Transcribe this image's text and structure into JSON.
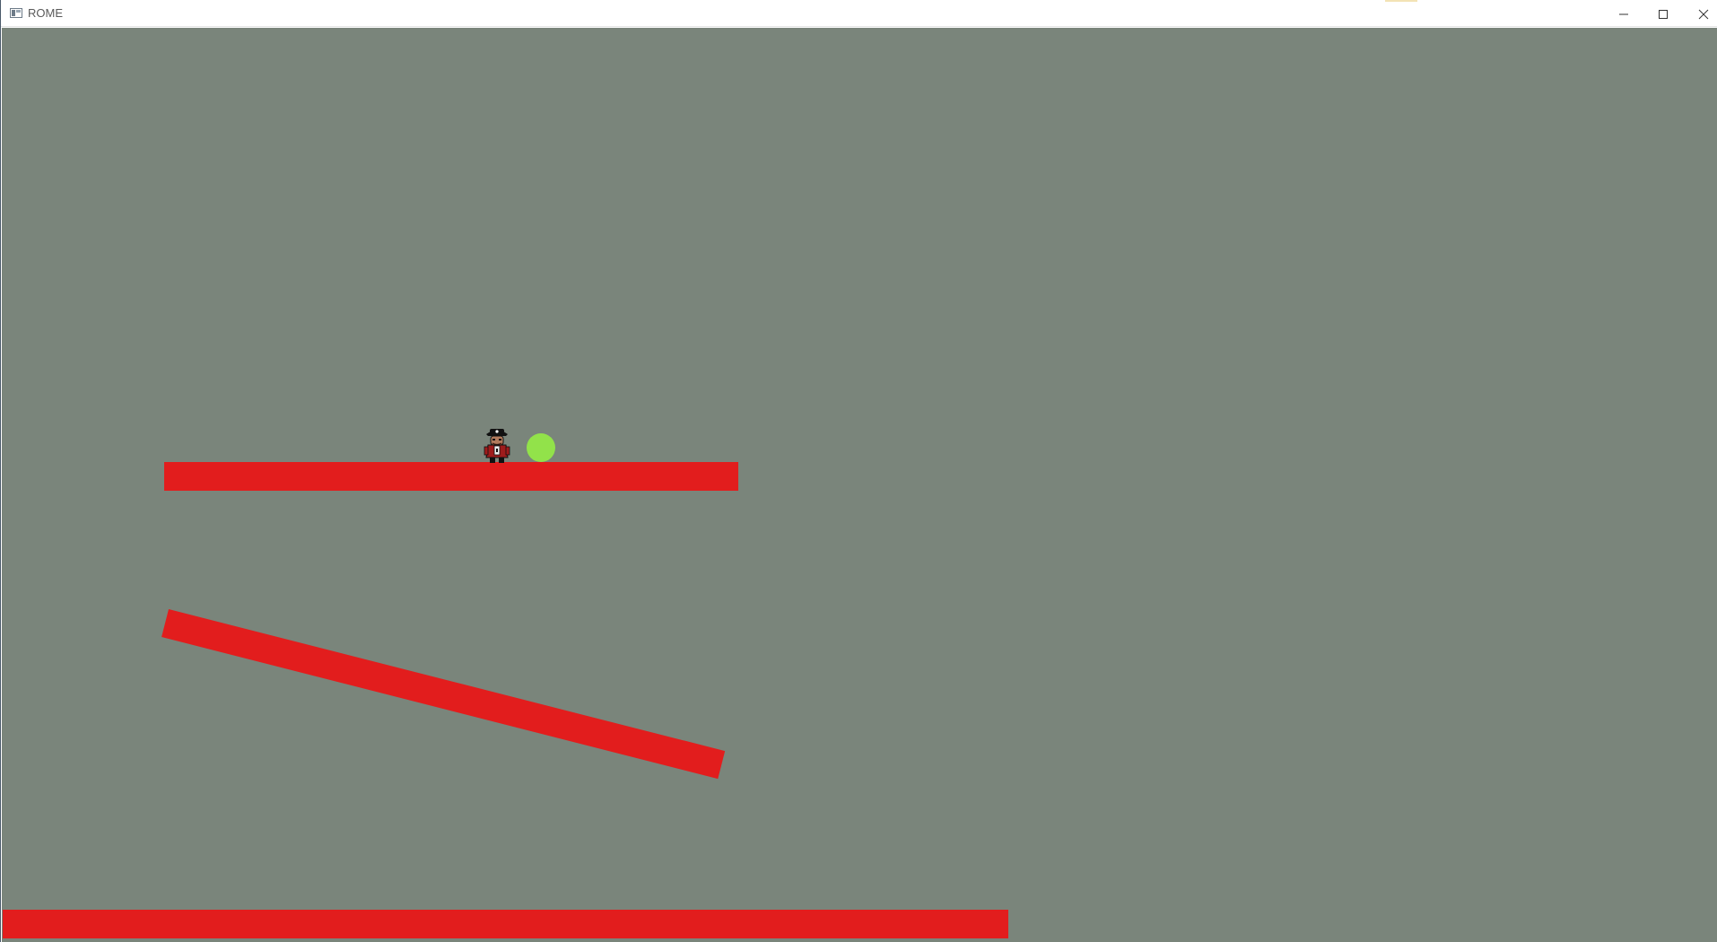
{
  "window": {
    "title": "ROME",
    "app_icon": "window-app-icon",
    "controls": {
      "minimize_icon": "minimize-icon",
      "maximize_icon": "maximize-icon",
      "close_icon": "close-icon"
    }
  },
  "game": {
    "background_color": "#7a857b",
    "platform_color": "#e21d1d",
    "ball_color": "#92e24a",
    "player_sprite": "pirate-character",
    "platforms": [
      "top-ledge",
      "slanted-ramp",
      "ground-floor"
    ]
  }
}
